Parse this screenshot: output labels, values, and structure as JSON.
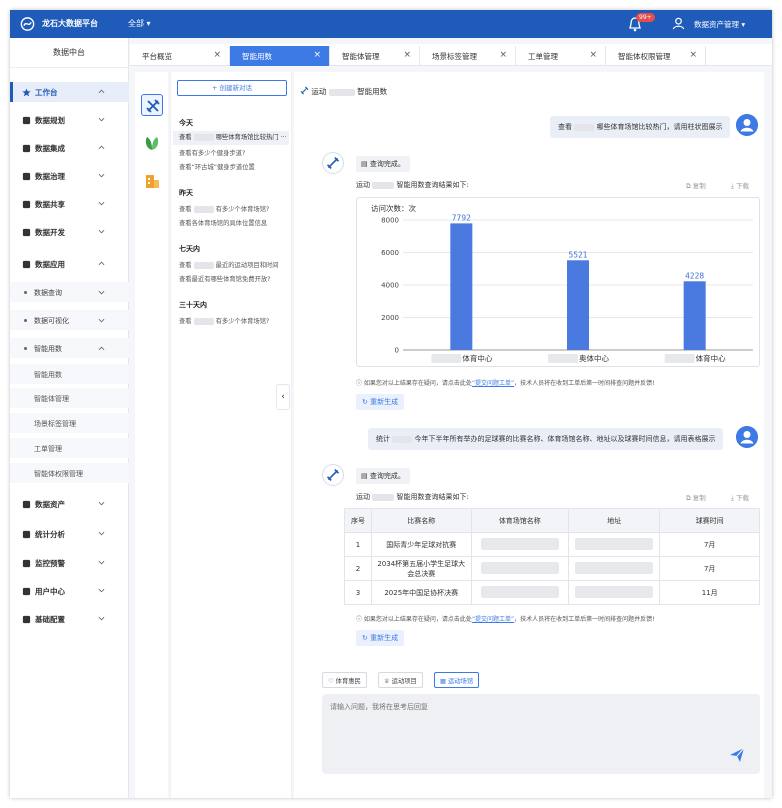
{
  "header": {
    "brand": "龙石大数据平台",
    "all_menu": "全部 ▾",
    "bell_badge": "99+",
    "user": "数据资产管理 ▾"
  },
  "sidebar": {
    "title": "数据中台",
    "items": [
      {
        "label": "工作台",
        "icon": "star-icon",
        "active": true,
        "chev": "up"
      },
      {
        "label": "数据规划",
        "icon": "layers-icon",
        "chev": "down"
      },
      {
        "label": "数据集成",
        "icon": "link-icon",
        "chev": "up"
      },
      {
        "label": "数据治理",
        "icon": "database-icon",
        "chev": "down"
      },
      {
        "label": "数据共享",
        "icon": "cloud-icon",
        "chev": "down"
      },
      {
        "label": "数据开发",
        "icon": "server-icon",
        "chev": "down"
      },
      {
        "label": "数据应用",
        "icon": "apps-icon",
        "chev": "up"
      }
    ],
    "sub_items": [
      {
        "label": "数据查询"
      },
      {
        "label": "数据可视化"
      },
      {
        "label": "智能用数"
      }
    ],
    "leaf_items": [
      "智能用数",
      "智能体管理",
      "场景标签管理",
      "工单管理",
      "智能体权限管理"
    ],
    "bottom_items": [
      {
        "label": "数据资产",
        "icon": "asset-icon"
      },
      {
        "label": "统计分析",
        "icon": "pie-icon"
      },
      {
        "label": "监控预警",
        "icon": "video-icon"
      },
      {
        "label": "用户中心",
        "icon": "user-icon"
      },
      {
        "label": "基础配置",
        "icon": "grid-icon"
      }
    ]
  },
  "tabs": [
    {
      "label": "平台概览"
    },
    {
      "label": "智能用数",
      "active": true
    },
    {
      "label": "智能体管理"
    },
    {
      "label": "场景标签管理"
    },
    {
      "label": "工单管理"
    },
    {
      "label": "智能体权限管理"
    }
  ],
  "history": {
    "new_chat": "+ 创建新对话",
    "groups": [
      {
        "title": "今天",
        "entries": [
          {
            "pre": "查看",
            "post": "哪些体育场馆比较热门",
            "selected": true,
            "more": "···"
          },
          {
            "pre": "",
            "post": "查看有多少个健身步道?"
          },
          {
            "pre": "",
            "post": "查看“环古城”健身步道位置"
          }
        ]
      },
      {
        "title": "昨天",
        "entries": [
          {
            "pre": "查看",
            "post": "有多少个体育场馆?"
          },
          {
            "pre": "",
            "post": "查看各体育场馆的具体位置信息"
          }
        ]
      },
      {
        "title": "七天内",
        "entries": [
          {
            "pre": "查看",
            "post": "最近的运动项目和时间"
          },
          {
            "pre": "",
            "post": "查看最近有哪些体育馆免费开放?"
          }
        ]
      },
      {
        "title": "三十天内",
        "entries": [
          {
            "pre": "查看",
            "post": "有多少个体育场馆?"
          }
        ]
      }
    ]
  },
  "chat": {
    "header_pre": "运动",
    "header_post": "智能用数",
    "q1_pre": "查看",
    "q1_post": "哪些体育场馆比较热门，请用柱状图展示",
    "status_done": "查询完成。",
    "result_pre": "运动",
    "result_post": "智能用数查询结果如下:",
    "copy": "复制",
    "download": "下载",
    "note_pre": "如果您对以上结果存在疑问，请点击此处",
    "note_link": "“提交问题工单”",
    "note_post": "，技术人员将在收到工单后第一时间排查问题并反馈!",
    "regen": "重新生成",
    "q2_pre": "统计",
    "q2_post": "今年下半年所有举办的足球赛的比赛名称、体育场馆名称、地址以及球赛时间信息，请用表格展示",
    "table_headers": [
      "序号",
      "比赛名称",
      "体育场馆名称",
      "地址",
      "球赛时间"
    ],
    "table_rows": [
      [
        "1",
        "国际青少年足球对抗赛",
        "",
        "",
        "7月"
      ],
      [
        "2",
        "2034杯第五届小学生足球大会总决赛",
        "",
        "",
        "7月"
      ],
      [
        "3",
        "2025年中国足协杯决赛",
        "",
        "",
        "11月"
      ]
    ],
    "chips": [
      "体育惠民",
      "运动项目",
      "运动场馆"
    ],
    "input_placeholder": "请输入问题，我将在思考后回复"
  },
  "chart_data": {
    "type": "bar",
    "ylabel": "访问次数：次",
    "categories": [
      "体育中心",
      "奥体中心",
      "体育中心"
    ],
    "values": [
      7792,
      5521,
      4228
    ],
    "ylim": [
      0,
      8000
    ],
    "yticks": [
      "8000",
      "6000",
      "4000",
      "2000",
      "0"
    ],
    "color": "#4a79df",
    "grid": true
  }
}
